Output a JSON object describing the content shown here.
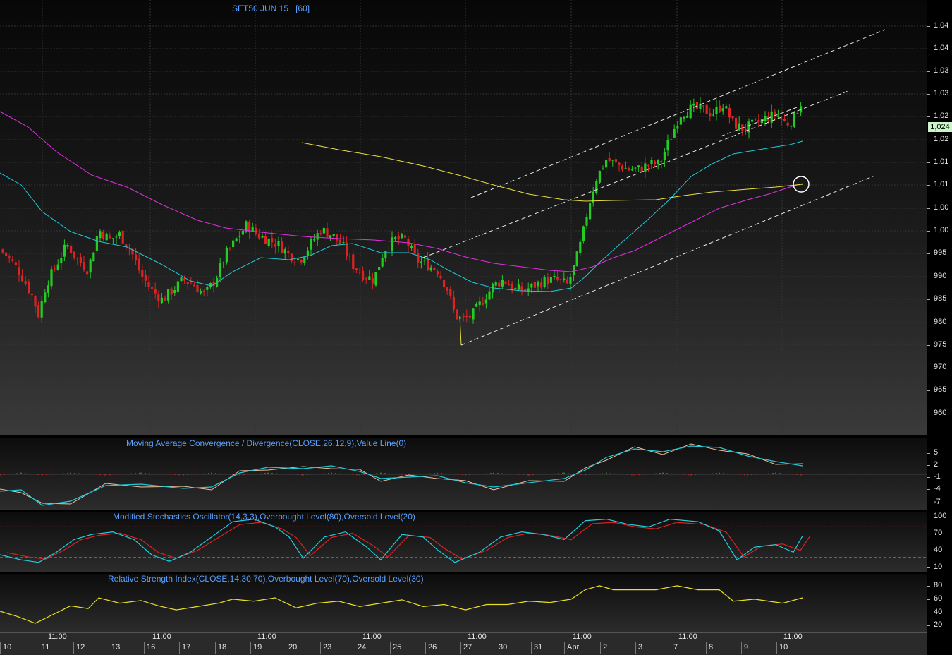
{
  "chart_data": [
    {
      "type": "candlestick",
      "title": "SET50 JUN 15",
      "interval": "[60]",
      "yaxis_labels": [
        "1,04",
        "1,04",
        "1,03",
        "1,03",
        "1,02",
        "1,02",
        "1,01",
        "1,01",
        "1,00",
        "1,00",
        "995",
        "990",
        "985",
        "980",
        "975",
        "970",
        "965",
        "960"
      ],
      "ylim": [
        957,
        1046
      ],
      "last_price": "1,024",
      "last_value": 1024,
      "overlays": [
        {
          "name": "fast moving average",
          "color": "#20c8d8"
        },
        {
          "name": "slow moving average",
          "color": "#e030e0"
        },
        {
          "name": "long moving average",
          "color": "#e8e040"
        }
      ],
      "trend_channel": {
        "lower_start": [
          27,
          975
        ],
        "lower_end": [
          10,
          1014
        ],
        "style": "dashed white",
        "lines": 4
      },
      "annotation": "circle at last moving average crossover",
      "grid": true,
      "up_color": "#22cc22",
      "down_color": "#dd2222"
    },
    {
      "type": "line",
      "title": "Moving Average Convergence / Divergence(CLOSE,26,12,9),Value Line(0)",
      "yaxis_labels": [
        "5",
        "2",
        "-1",
        "-4",
        "-7"
      ],
      "series_colors": {
        "macd": "#20c8d8",
        "signal": "#f0c0a0",
        "histogram_up": "#22cc22",
        "histogram_down": "#dd2222"
      }
    },
    {
      "type": "line",
      "title": "Modified Stochastics Oscillator(14,3,3),Overbought Level(80),Oversold Level(20)",
      "yaxis_labels": [
        "100",
        "70",
        "40",
        "10"
      ],
      "levels": {
        "overbought": 80,
        "oversold": 20
      },
      "series_colors": {
        "k": "#20d0e0",
        "d": "#dd2222"
      }
    },
    {
      "type": "line",
      "title": "Relative Strength Index(CLOSE,14,30,70),Overbought Level(70),Oversold Level(30)",
      "yaxis_labels": [
        "80",
        "60",
        "40",
        "20"
      ],
      "levels": {
        "overbought": 70,
        "oversold": 30
      },
      "series_colors": {
        "rsi": "#e8e020"
      }
    }
  ],
  "x_axis": {
    "day_labels": [
      "10",
      "11",
      "12",
      "13",
      "16",
      "17",
      "18",
      "19",
      "20",
      "23",
      "24",
      "25",
      "26",
      "27",
      "30",
      "31",
      "Apr",
      "2",
      "3",
      "7",
      "8",
      "9",
      "10"
    ],
    "time_labels": [
      "11:00",
      "11:00",
      "11:00",
      "11:00",
      "11:00",
      "11:00",
      "11:00",
      "11:00"
    ]
  }
}
